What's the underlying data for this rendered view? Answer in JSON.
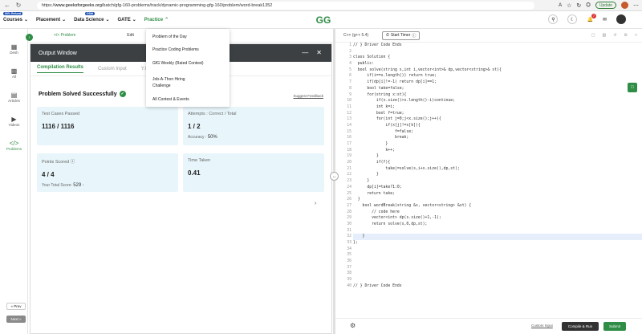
{
  "browser": {
    "url_prefix": "https://",
    "url_domain": "www.geeksforgeeks.org",
    "url_path": "/batch/gfg-160-problems/track/dynamic-programming-gfg-160/problem/word-break1352",
    "update_label": "Update"
  },
  "nav": {
    "courses_badge": "90% Refund",
    "courses": "Courses",
    "placement": "Placement",
    "ds_badge": "DSM",
    "data_science": "Data Science",
    "gate": "GATE",
    "practice": "Practice",
    "logo": "GG",
    "notif_count": "7"
  },
  "sidebar": {
    "items": [
      {
        "label": "Desh"
      },
      {
        "label": "All"
      },
      {
        "label": "Articles"
      },
      {
        "label": "Videos"
      },
      {
        "label": "Problems"
      }
    ],
    "prev": "« Prev",
    "next": "Next »"
  },
  "toptabs": {
    "problem": "</> Problem",
    "editorial": "Edit",
    "tab3": "s"
  },
  "output": {
    "title": "Output Window",
    "tabs": [
      "Compilation Results",
      "Custom Input",
      "Y.O."
    ],
    "solved": "Problem Solved Successfully",
    "feedback": "Suggest Feedback",
    "test_label": "Test Cases Passed",
    "test_value": "1116 / 1116",
    "attempts_label": "Attempts : Correct / Total",
    "attempts_value": "1 / 2",
    "accuracy_label": "Accuracy :",
    "accuracy_value": "50%",
    "points_label": "Points Scored",
    "points_value": "4 / 4",
    "total_label": "Your Total Score:",
    "total_value": "529",
    "time_label": "Time Taken",
    "time_value": "0.41"
  },
  "dropdown": {
    "items": [
      "Problem of the Day",
      "Practice Coding Problems",
      "GfG Weekly (Rated Contest)",
      "Job-A-Thon Hiring Challenge",
      "All Contest & Events"
    ]
  },
  "editor": {
    "lang": "C++ (g++ 5.4)",
    "timer": "Start Timer",
    "lines": [
      "// } Driver Code Ends",
      "",
      "class Solution {",
      "  public:",
      "  bool solve(string s,int i,vector<int>& dp,vector<string>& st){",
      "      if(i==s.length()) return true;",
      "      if(dp[i]!=-1) return dp[i]==1;",
      "      bool take=false;",
      "      for(string x:st){",
      "          if(x.size()>s.length()-i)continue;",
      "          int k=i;",
      "          bool f=true;",
      "          for(int j=0;j<x.size();j++){",
      "              if(x[j]!=s[k]){",
      "                  f=false;",
      "                  break;",
      "              }",
      "              k++;",
      "          }",
      "          if(f){",
      "              take|=solve(s,i+x.size(),dp,st);",
      "          }",
      "      }",
      "      dp[i]=take?1:0;",
      "      return take;",
      "  }",
      "    bool wordBreak(string &s, vector<string> &st) {",
      "        // code here",
      "        vector<int> dp(s.size()+1,-1);",
      "        return solve(s,0,dp,st);",
      "",
      "    }",
      "};",
      "",
      "",
      "",
      "",
      "",
      "",
      "// } Driver Code Ends"
    ],
    "custom_input": "Custom Input",
    "compile": "Compile & Run",
    "submit": "Submit"
  }
}
